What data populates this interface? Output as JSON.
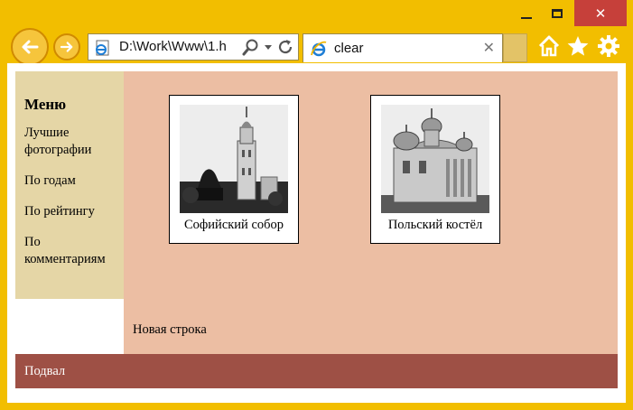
{
  "window": {
    "minimize_icon": "minimize-icon",
    "maximize_icon": "maximize-icon",
    "close_glyph": "✕"
  },
  "toolbar": {
    "address_url": "D:\\Work\\Www\\1.h",
    "tab_title": "clear",
    "tab_close_glyph": "✕"
  },
  "sidebar": {
    "heading": "Меню",
    "items": [
      {
        "label": "Лучшие фотографии"
      },
      {
        "label": "По годам"
      },
      {
        "label": "По рейтингу"
      },
      {
        "label": "По комментариям"
      }
    ]
  },
  "gallery": [
    {
      "caption": "Софийский собор",
      "icon": "sofia-cathedral-photo"
    },
    {
      "caption": "Польский костёл",
      "icon": "polish-church-photo"
    }
  ],
  "content": {
    "newline_text": "Новая строка"
  },
  "footer": {
    "text": "Подвал"
  },
  "colors": {
    "chrome": "#f2be00",
    "sidebar": "#e5d6a6",
    "content": "#ecbea3",
    "footer": "#9e5045",
    "close_button": "#c6403a"
  }
}
